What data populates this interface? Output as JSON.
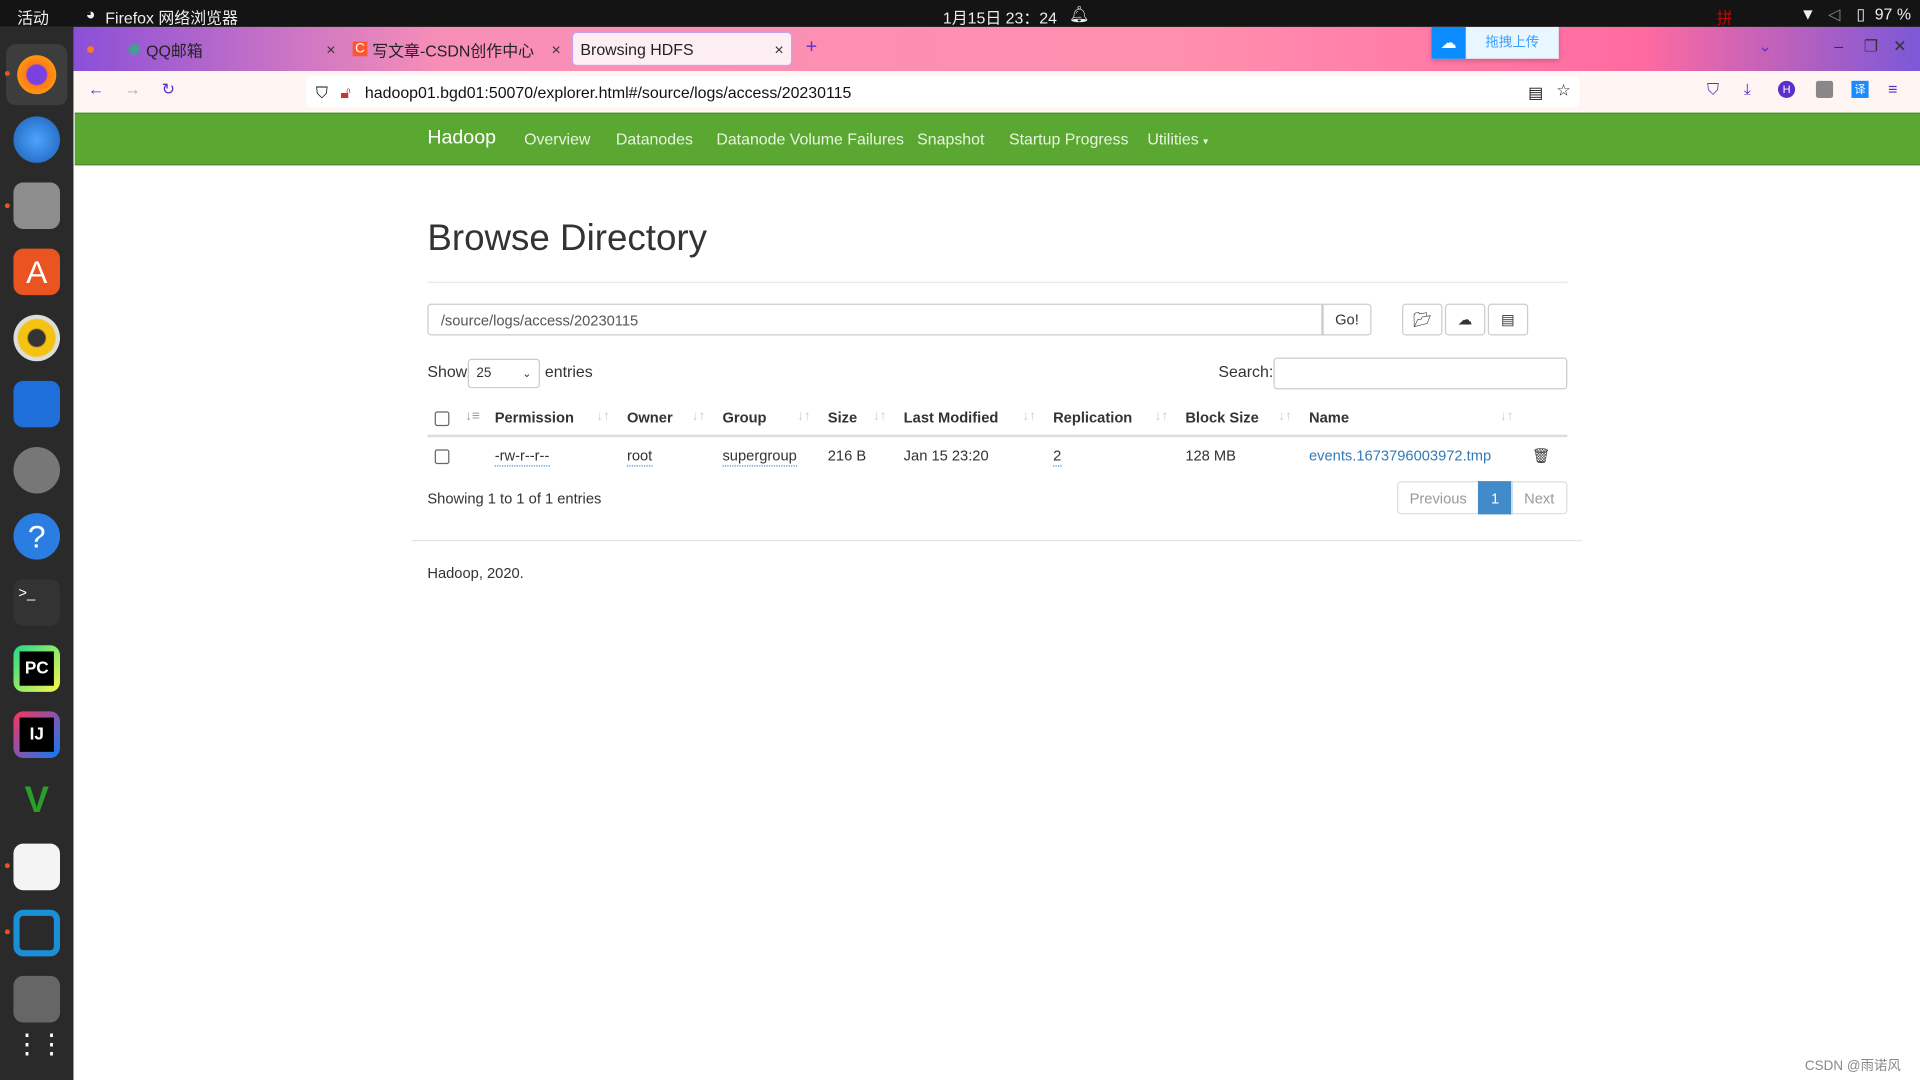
{
  "system": {
    "activities": "活动",
    "app_name": "Firefox 网络浏览器",
    "clock": "1月15日 23：24",
    "battery": "97 %",
    "ime": "拼"
  },
  "browser": {
    "tabs": [
      {
        "label": "QQ邮箱"
      },
      {
        "label": "写文章-CSDN创作中心"
      },
      {
        "label": "Browsing HDFS",
        "active": true
      }
    ],
    "url": "hadoop01.bgd01:50070/explorer.html#/source/logs/access/20230115",
    "upload_widget": "拖拽上传"
  },
  "hadoop_nav": {
    "brand": "Hadoop",
    "items": [
      "Overview",
      "Datanodes",
      "Datanode Volume Failures",
      "Snapshot",
      "Startup Progress",
      "Utilities"
    ]
  },
  "page": {
    "title": "Browse Directory",
    "path_value": "/source/logs/access/20230115",
    "go_label": "Go!",
    "show_label": "Show",
    "entries_value": "25",
    "entries_label": "entries",
    "search_label": "Search:",
    "columns": [
      "Permission",
      "Owner",
      "Group",
      "Size",
      "Last Modified",
      "Replication",
      "Block Size",
      "Name"
    ],
    "rows": [
      {
        "permission": "-rw-r--r--",
        "owner": "root",
        "group": "supergroup",
        "size": "216 B",
        "last_modified": "Jan 15 23:20",
        "replication": "2",
        "block_size": "128 MB",
        "name": "events.1673796003972.tmp"
      }
    ],
    "info": "Showing 1 to 1 of 1 entries",
    "pagination": {
      "previous": "Previous",
      "current": "1",
      "next": "Next"
    },
    "footer": "Hadoop, 2020."
  },
  "watermark": "CSDN @雨诺风",
  "colors": {
    "hadoop_green": "#5aa832",
    "link": "#337ab7",
    "page_active": "#428bca"
  }
}
